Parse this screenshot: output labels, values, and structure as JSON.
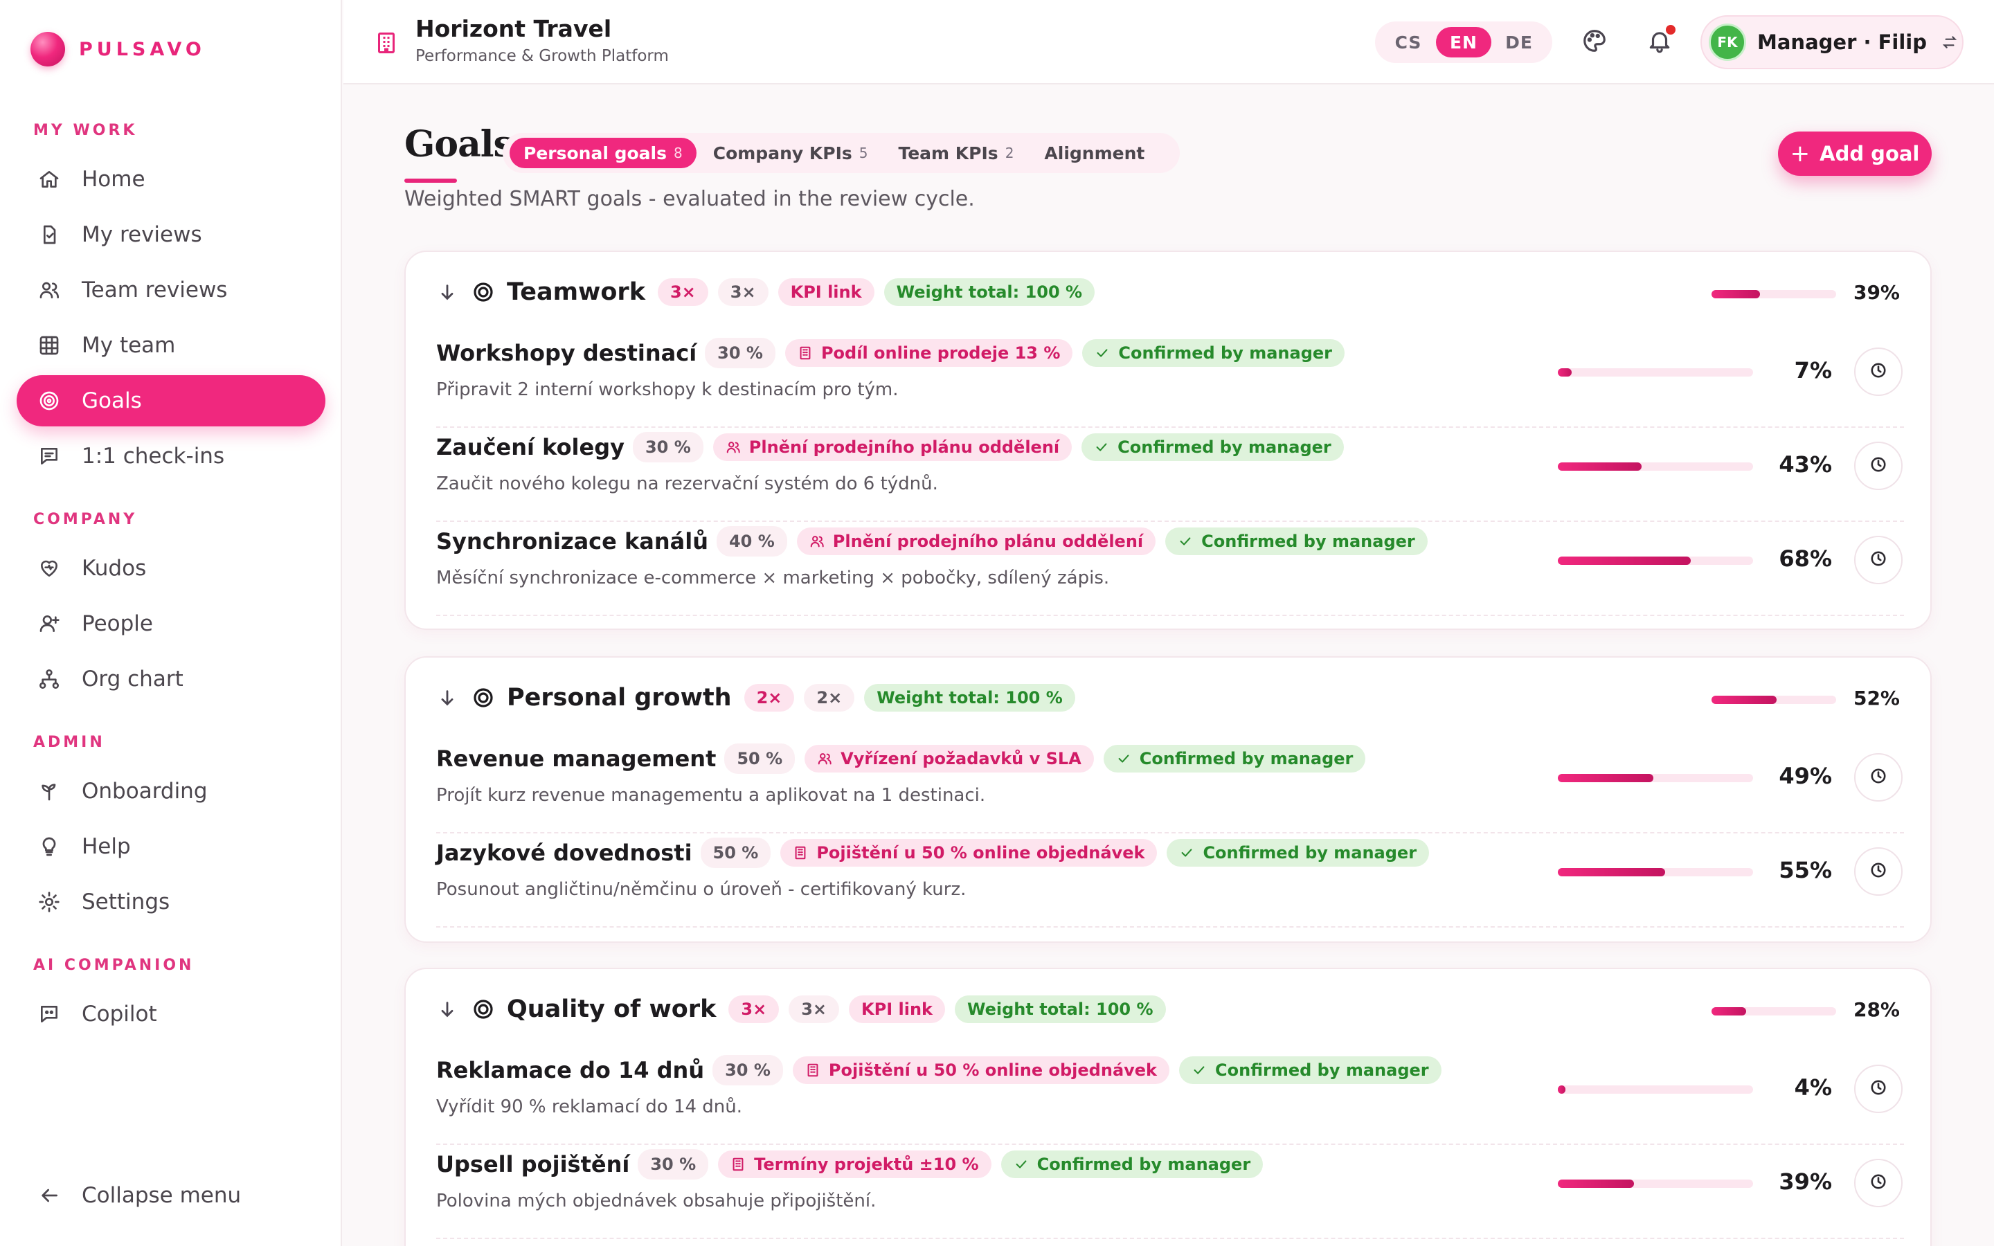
{
  "brand": {
    "name": "PULSAVO"
  },
  "sidebar": {
    "sections": {
      "my_work": "MY WORK",
      "company": "COMPANY",
      "admin": "ADMIN",
      "ai": "AI COMPANION"
    },
    "items": [
      {
        "label": "Home",
        "icon": "home-icon"
      },
      {
        "label": "My reviews",
        "icon": "clipboard-check-icon"
      },
      {
        "label": "Team reviews",
        "icon": "users-icon"
      },
      {
        "label": "My team",
        "icon": "grid-icon"
      },
      {
        "label": "Goals",
        "icon": "target-icon",
        "active": true
      },
      {
        "label": "1:1 check-ins",
        "icon": "chat-icon"
      },
      {
        "label": "Kudos",
        "icon": "heart-icon"
      },
      {
        "label": "People",
        "icon": "user-plus-icon"
      },
      {
        "label": "Org chart",
        "icon": "org-chart-icon"
      },
      {
        "label": "Onboarding",
        "icon": "sprout-icon"
      },
      {
        "label": "Help",
        "icon": "lightbulb-icon"
      },
      {
        "label": "Settings",
        "icon": "gear-icon"
      },
      {
        "label": "Copilot",
        "icon": "bot-chat-icon"
      }
    ],
    "collapse": "Collapse menu"
  },
  "header": {
    "org_name": "Horizont Travel",
    "org_sub": "Performance & Growth Platform",
    "languages": [
      "CS",
      "EN",
      "DE"
    ],
    "active_language": "EN",
    "user": {
      "initials": "FK",
      "name": "Manager · Filip"
    }
  },
  "page": {
    "title": "Goals",
    "subtitle": "Weighted SMART goals - evaluated in the review cycle.",
    "add_button": "Add goal",
    "tabs": [
      {
        "label": "Personal goals",
        "count": "8",
        "active": true
      },
      {
        "label": "Company KPIs",
        "count": "5"
      },
      {
        "label": "Team KPIs",
        "count": "2"
      },
      {
        "label": "Alignment",
        "count": ""
      }
    ]
  },
  "categories": [
    {
      "title": "Teamwork",
      "chips": [
        {
          "text": "3×",
          "style": "pink"
        },
        {
          "text": "3×",
          "style": "grey"
        },
        {
          "text": "KPI link",
          "style": "pink"
        },
        {
          "text": "Weight total: 100 %",
          "style": "green"
        }
      ],
      "progress": 39,
      "progress_label": "39%",
      "goals": [
        {
          "title": "Workshopy destinací",
          "weight": "30 %",
          "kpi": "Podíl online prodeje 13 %",
          "kpi_icon": "building-icon",
          "status": "Confirmed by manager",
          "desc": "Připravit 2 interní workshopy k destinacím pro tým.",
          "progress": 7,
          "progress_label": "7%"
        },
        {
          "title": "Zaučení kolegy",
          "weight": "30 %",
          "kpi": "Plnění prodejního plánu oddělení",
          "kpi_icon": "users-icon",
          "status": "Confirmed by manager",
          "desc": "Zaučit nového kolegu na rezervační systém do 6 týdnů.",
          "progress": 43,
          "progress_label": "43%"
        },
        {
          "title": "Synchronizace kanálů",
          "weight": "40 %",
          "kpi": "Plnění prodejního plánu oddělení",
          "kpi_icon": "users-icon",
          "status": "Confirmed by manager",
          "desc": "Měsíční synchronizace e-commerce × marketing × pobočky, sdílený zápis.",
          "progress": 68,
          "progress_label": "68%"
        }
      ]
    },
    {
      "title": "Personal growth",
      "chips": [
        {
          "text": "2×",
          "style": "pink"
        },
        {
          "text": "2×",
          "style": "grey"
        },
        {
          "text": "Weight total: 100 %",
          "style": "green"
        }
      ],
      "progress": 52,
      "progress_label": "52%",
      "goals": [
        {
          "title": "Revenue management",
          "weight": "50 %",
          "kpi": "Vyřízení požadavků v SLA",
          "kpi_icon": "users-icon",
          "status": "Confirmed by manager",
          "desc": "Projít kurz revenue managementu a aplikovat na 1 destinaci.",
          "progress": 49,
          "progress_label": "49%"
        },
        {
          "title": "Jazykové dovednosti",
          "weight": "50 %",
          "kpi": "Pojištění u 50 % online objednávek",
          "kpi_icon": "building-icon",
          "status": "Confirmed by manager",
          "desc": "Posunout angličtinu/němčinu o úroveň - certifikovaný kurz.",
          "progress": 55,
          "progress_label": "55%"
        }
      ]
    },
    {
      "title": "Quality of work",
      "chips": [
        {
          "text": "3×",
          "style": "pink"
        },
        {
          "text": "3×",
          "style": "grey"
        },
        {
          "text": "KPI link",
          "style": "pink"
        },
        {
          "text": "Weight total: 100 %",
          "style": "green"
        }
      ],
      "progress": 28,
      "progress_label": "28%",
      "goals": [
        {
          "title": "Reklamace do 14 dnů",
          "weight": "30 %",
          "kpi": "Pojištění u 50 % online objednávek",
          "kpi_icon": "building-icon",
          "status": "Confirmed by manager",
          "desc": "Vyřídit 90 % reklamací do 14 dnů.",
          "progress": 4,
          "progress_label": "4%"
        },
        {
          "title": "Upsell pojištění",
          "weight": "30 %",
          "kpi": "Termíny projektů ±10 %",
          "kpi_icon": "building-icon",
          "status": "Confirmed by manager",
          "desc": "Polovina mých objednávek obsahuje připojištění.",
          "progress": 39,
          "progress_label": "39%"
        }
      ]
    }
  ],
  "colors": {
    "accent": "#f0287e",
    "success": "#268a2b",
    "success_bg": "#dff3dc",
    "chip_bg": "#fde4ee"
  }
}
